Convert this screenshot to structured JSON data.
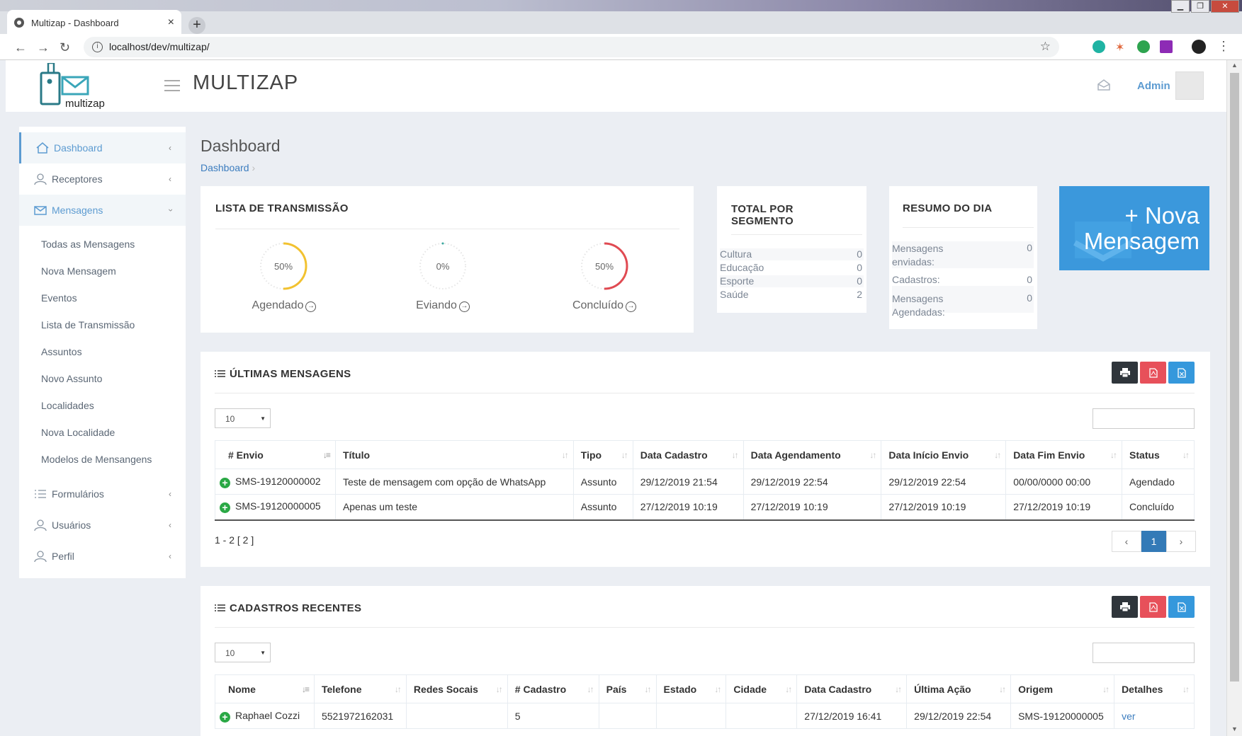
{
  "browser": {
    "tab_title": "Multizap - Dashboard",
    "tab_close": "×",
    "new_tab": "+",
    "url": "localhost/dev/multizap/",
    "window_buttons": [
      "▁",
      "❐",
      "✕"
    ]
  },
  "header": {
    "app_name": "MULTIZAP",
    "logo_text": "multizap",
    "user": "Admin"
  },
  "sidebar": {
    "items": [
      {
        "label": "Dashboard",
        "icon": "home-icon"
      },
      {
        "label": "Receptores",
        "icon": "users-icon"
      },
      {
        "label": "Mensagens",
        "icon": "envelope-icon"
      },
      {
        "label": "Formulários",
        "icon": "list-icon"
      },
      {
        "label": "Usuários",
        "icon": "user-icon"
      },
      {
        "label": "Perfil",
        "icon": "user-icon"
      }
    ],
    "submenu": [
      "Todas as Mensagens",
      "Nova Mensagem",
      "Eventos",
      "Lista de Transmissão",
      "Assuntos",
      "Novo Assunto",
      "Localidades",
      "Nova Localidade",
      "Modelos de Mensangens"
    ]
  },
  "page": {
    "title": "Dashboard",
    "breadcrumb": "Dashboard",
    "breadcrumb_sep": "›"
  },
  "lista": {
    "title": "LISTA DE TRANSMISSÃO",
    "gauges": [
      {
        "label": "Agendado",
        "percent_text": "50%",
        "value": 50,
        "color": "#f2c230"
      },
      {
        "label": "Eviando",
        "percent_text": "0%",
        "value": 0,
        "color": "#3ba9a0"
      },
      {
        "label": "Concluído",
        "percent_text": "50%",
        "value": 50,
        "color": "#e04a52"
      }
    ]
  },
  "segmento": {
    "title_line1": "TOTAL POR",
    "title_line2": "SEGMENTO",
    "rows": [
      {
        "label": "Cultura",
        "value": "0"
      },
      {
        "label": "Educação",
        "value": "0"
      },
      {
        "label": "Esporte",
        "value": "0"
      },
      {
        "label": "Saúde",
        "value": "2"
      }
    ]
  },
  "resumo": {
    "title": "RESUMO DO DIA",
    "rows": [
      {
        "label1": "Mensagens",
        "label2": "enviadas:",
        "value": "0"
      },
      {
        "label1": "Cadastros:",
        "label2": "",
        "value": "0"
      },
      {
        "label1": "Mensagens",
        "label2": "Agendadas:",
        "value": "0"
      }
    ]
  },
  "nova": {
    "line1": "+ Nova",
    "line2": "Mensagem"
  },
  "ultimas": {
    "title": "ÚLTIMAS MENSAGENS",
    "page_size": "10",
    "columns": [
      "# Envio",
      "Título",
      "Tipo",
      "Data Cadastro",
      "Data Agendamento",
      "Data Início Envio",
      "Data Fim Envio",
      "Status"
    ],
    "rows": [
      [
        "SMS-19120000002",
        "Teste de mensagem com opção de WhatsApp",
        "Assunto",
        "29/12/2019 21:54",
        "29/12/2019 22:54",
        "29/12/2019 22:54",
        "00/00/0000 00:00",
        "Agendado"
      ],
      [
        "SMS-19120000005",
        "Apenas um teste",
        "Assunto",
        "27/12/2019 10:19",
        "27/12/2019 10:19",
        "27/12/2019 10:19",
        "27/12/2019 10:19",
        "Concluído"
      ]
    ],
    "summary": "1 - 2 [ 2 ]",
    "pager": [
      "‹",
      "1",
      "›"
    ]
  },
  "cadastros": {
    "title": "CADASTROS RECENTES",
    "page_size": "10",
    "columns": [
      "Nome",
      "Telefone",
      "Redes Socais",
      "# Cadastro",
      "País",
      "Estado",
      "Cidade",
      "Data Cadastro",
      "Última Ação",
      "Origem",
      "Detalhes"
    ],
    "rows": [
      [
        "Raphael Cozzi",
        "5521972162031",
        "",
        "5",
        "",
        "",
        "",
        "27/12/2019 16:41",
        "29/12/2019 22:54",
        "SMS-19120000005",
        "ver"
      ]
    ]
  },
  "colors": {
    "accent": "#5c9bd1",
    "nova_bg": "#3b98dc",
    "btn_print": "#2f353b",
    "btn_pdf": "#e7505a",
    "btn_excel": "#3598dc",
    "plus_badge": "#2aa845"
  }
}
